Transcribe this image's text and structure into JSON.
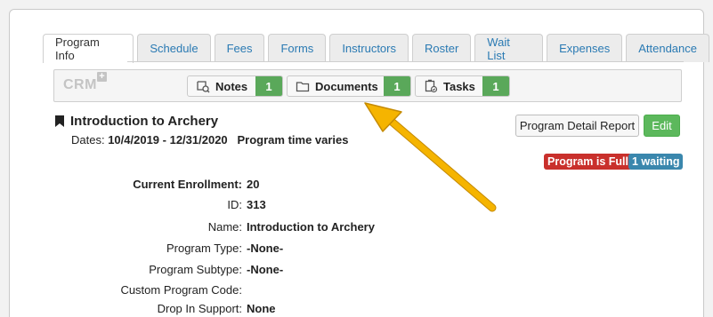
{
  "tabs": [
    "Program Info",
    "Schedule",
    "Fees",
    "Forms",
    "Instructors",
    "Roster",
    "Wait List",
    "Expenses",
    "Attendance"
  ],
  "crm": {
    "logo": "CRM",
    "plus": "+",
    "notes": {
      "label": "Notes",
      "count": "1"
    },
    "documents": {
      "label": "Documents",
      "count": "1"
    },
    "tasks": {
      "label": "Tasks",
      "count": "1"
    }
  },
  "program": {
    "title": "Introduction to Archery",
    "dates_label": "Dates:",
    "dates_value": "10/4/2019 - 12/31/2020",
    "time_note": "Program time varies"
  },
  "actions": {
    "report": "Program Detail Report",
    "edit": "Edit"
  },
  "badges": {
    "full": "Program is Full",
    "waiting": "1 waiting"
  },
  "details": [
    {
      "label": "Current Enrollment:",
      "value": "20"
    },
    {
      "label": "ID:",
      "value": "313"
    },
    {
      "label": "Name:",
      "value": "Introduction to Archery"
    },
    {
      "label": "Program Type:",
      "value": "-None-"
    },
    {
      "label": "Program Subtype:",
      "value": "-None-"
    },
    {
      "label": "Custom Program Code:",
      "value": ""
    },
    {
      "label": "Drop In Support:",
      "value": "None"
    }
  ],
  "colors": {
    "link": "#2a7ab3",
    "count_green": "#5aa85a",
    "edit_green": "#5cb85c",
    "full_red": "#c9302c",
    "waiting_blue": "#3a87ad",
    "arrow": "#f5b400"
  }
}
